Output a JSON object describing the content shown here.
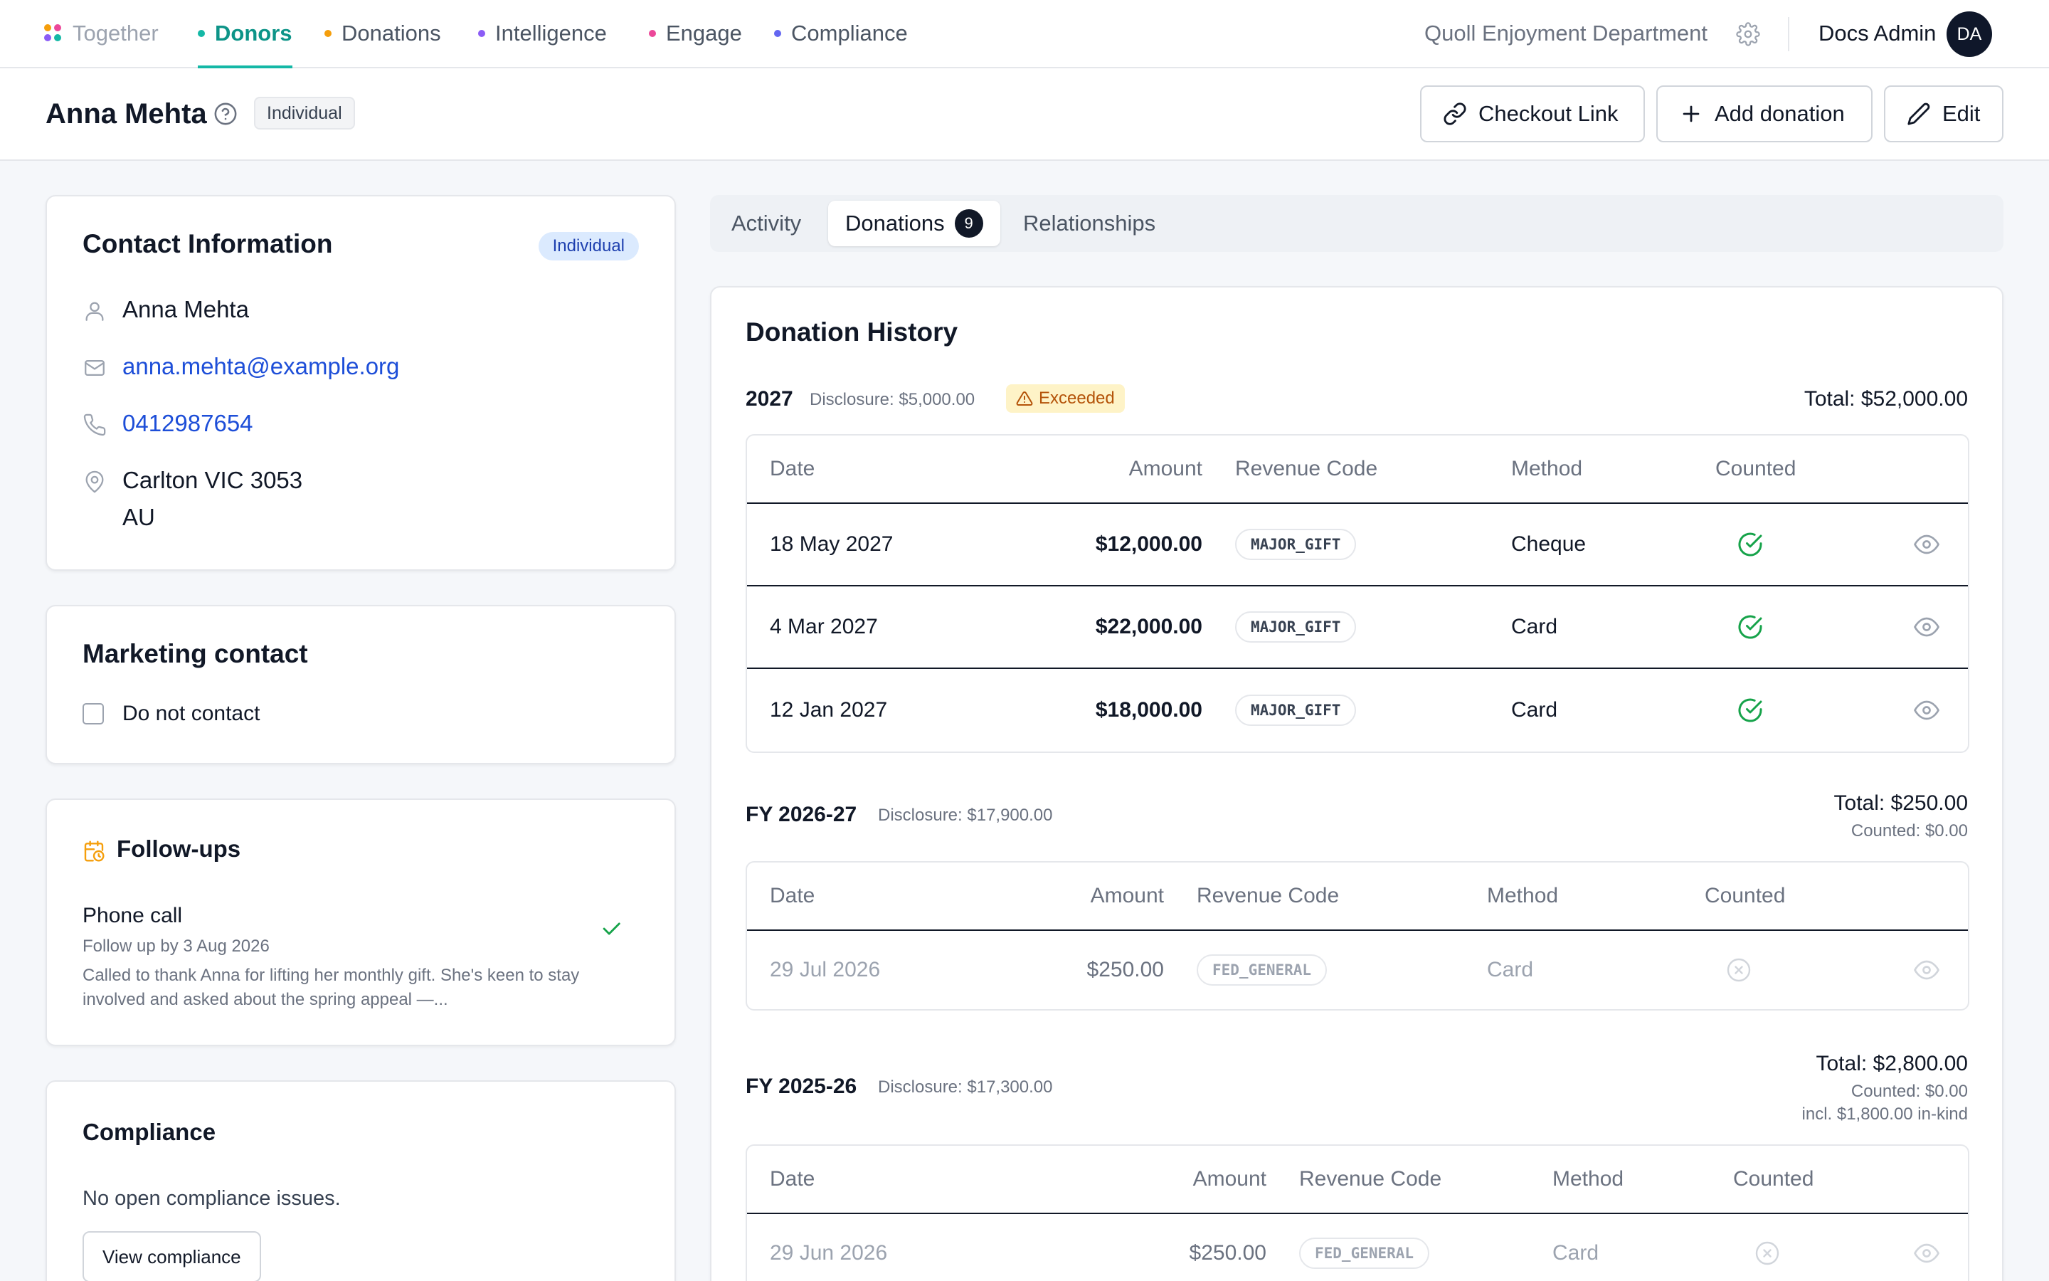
{
  "nav": {
    "brand": "Together",
    "tabs": [
      {
        "label": "Donors",
        "dot": "#14b8a6"
      },
      {
        "label": "Donations",
        "dot": "#f59e0b"
      },
      {
        "label": "Intelligence",
        "dot": "#8b5cf6"
      },
      {
        "label": "Engage",
        "dot": "#ec4899"
      },
      {
        "label": "Compliance",
        "dot": "#6366f1"
      }
    ],
    "active_tab": "Donors",
    "org_name": "Quoll Enjoyment Department",
    "user_name": "Docs Admin",
    "user_initials": "DA"
  },
  "header": {
    "donor_name": "Anna Mehta",
    "type_tag": "Individual",
    "buttons": {
      "checkout": "Checkout Link",
      "add_donation": "Add donation",
      "edit": "Edit"
    }
  },
  "contact": {
    "title": "Contact Information",
    "badge": "Individual",
    "name": "Anna Mehta",
    "email": "anna.mehta@example.org",
    "phone": "0412987654",
    "address_line1": "Carlton VIC 3053",
    "address_line2": "AU"
  },
  "marketing": {
    "title": "Marketing contact",
    "do_not_contact_label": "Do not contact",
    "do_not_contact_checked": false
  },
  "followups": {
    "title": "Follow-ups",
    "items": [
      {
        "title": "Phone call",
        "due": "Follow up by 3 Aug 2026",
        "body": "Called to thank Anna for lifting her monthly gift. She's keen to stay involved and asked about the spring appeal —...",
        "done": true
      }
    ]
  },
  "compliance": {
    "title": "Compliance",
    "status": "No open compliance issues.",
    "button": "View compliance"
  },
  "tabs": {
    "activity": "Activity",
    "donations": "Donations",
    "donations_count": "9",
    "relationships": "Relationships",
    "active": "Donations"
  },
  "history": {
    "title": "Donation History",
    "columns": {
      "date": "Date",
      "amount": "Amount",
      "revenue_code": "Revenue Code",
      "method": "Method",
      "counted": "Counted"
    },
    "groups": [
      {
        "label": "2027",
        "disclosure": "Disclosure: $5,000.00",
        "warning": "Exceeded",
        "total": "Total: $52,000.00",
        "rows": [
          {
            "date": "18 May 2027",
            "amount": "$12,000.00",
            "code": "MAJOR_GIFT",
            "method": "Cheque",
            "counted": true
          },
          {
            "date": "4 Mar 2027",
            "amount": "$22,000.00",
            "code": "MAJOR_GIFT",
            "method": "Card",
            "counted": true
          },
          {
            "date": "12 Jan 2027",
            "amount": "$18,000.00",
            "code": "MAJOR_GIFT",
            "method": "Card",
            "counted": true
          }
        ]
      },
      {
        "label": "FY 2026-27",
        "disclosure": "Disclosure: $17,900.00",
        "total": "Total: $250.00",
        "counted": "Counted: $0.00",
        "rows": [
          {
            "date": "29 Jul 2026",
            "amount": "$250.00",
            "code": "FED_GENERAL",
            "method": "Card",
            "counted": false
          }
        ]
      },
      {
        "label": "FY 2025-26",
        "disclosure": "Disclosure: $17,300.00",
        "total": "Total: $2,800.00",
        "counted": "Counted: $0.00",
        "in_kind": "incl. $1,800.00 in-kind",
        "rows": [
          {
            "date": "29 Jun 2026",
            "amount": "$250.00",
            "code": "FED_GENERAL",
            "method": "Card",
            "counted": false
          }
        ]
      }
    ]
  },
  "colors": {
    "accent_teal": "#14b8a6",
    "link_blue": "#1d4ed8",
    "success_green": "#16a34a",
    "warning_amber": "#b45309",
    "followup_orange": "#f59e0b"
  }
}
